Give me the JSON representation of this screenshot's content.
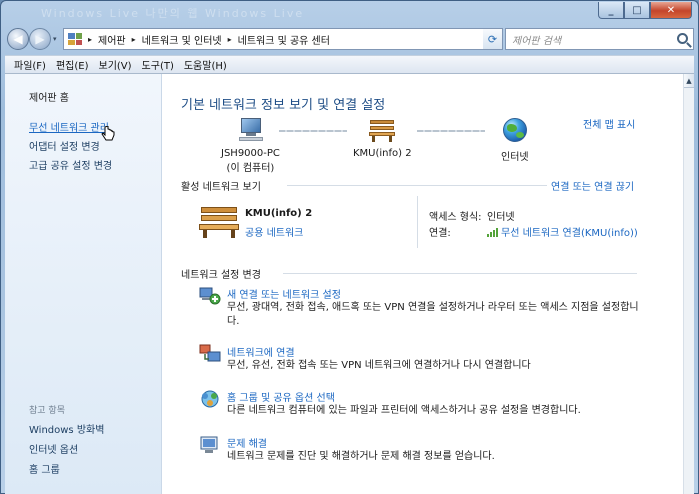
{
  "window": {
    "title_ghost": "Windows Live   나만의 웹   Windows Live",
    "min_glyph": "_",
    "max_glyph": "□",
    "close_glyph": "✕"
  },
  "navigation": {
    "back_glyph": "◀",
    "forward_glyph": "▶",
    "dropdown_glyph": "▾",
    "breadcrumbs": [
      "제어판",
      "네트워크 및 인터넷",
      "네트워크 및 공유 센터"
    ],
    "separator": "▸",
    "refresh_glyph": "⟳",
    "search_placeholder": "제어판 검색"
  },
  "menu": {
    "items": [
      "파일(F)",
      "편집(E)",
      "보기(V)",
      "도구(T)",
      "도움말(H)"
    ]
  },
  "sidebar": {
    "home": "제어판 홈",
    "links": [
      "무선 네트워크 관리",
      "어댑터 설정 변경",
      "고급 공유 설정 변경"
    ],
    "see_also_title": "참고 항목",
    "see_also": [
      "Windows 방화벽",
      "인터넷 옵션",
      "홈 그룹"
    ]
  },
  "main": {
    "title": "기본 네트워크 정보 보기 및 연결 설정",
    "full_map_link": "전체 맵 표시",
    "map": {
      "computer_name": "JSH9000-PC",
      "computer_sub": "(이 컴퓨터)",
      "network_name": "KMU(info)  2",
      "internet_label": "인터넷"
    },
    "active": {
      "section_title": "활성 네트워크 보기",
      "connect_link": "연결 또는 연결 끊기",
      "network_name": "KMU(info)  2",
      "network_type": "공용 네트워크",
      "access_label": "액세스 형식:",
      "access_value": "인터넷",
      "connection_label": "연결:",
      "connection_value": "무선 네트워크 연결(KMU(info))"
    },
    "settings": {
      "section_title": "네트워크 설정 변경",
      "tasks": [
        {
          "title": "새 연결 또는 네트워크 설정",
          "desc": "무선, 광대역, 전화 접속, 애드혹 또는 VPN 연결을 설정하거나 라우터 또는 액세스 지점을 설정합니다."
        },
        {
          "title": "네트워크에 연결",
          "desc": "무선, 유선, 전화 접속 또는 VPN 네트워크에 연결하거나 다시 연결합니다"
        },
        {
          "title": "홈 그룹 및 공유 옵션 선택",
          "desc": "다른 네트워크 컴퓨터에 있는 파일과 프린터에 액세스하거나 공유 설정을 변경합니다."
        },
        {
          "title": "문제 해결",
          "desc": "네트워크 문제를 진단 및 해결하거나 문제 해결 정보를 얻습니다."
        }
      ]
    }
  },
  "colors": {
    "link": "#1b67c2",
    "title": "#1e4d86"
  }
}
